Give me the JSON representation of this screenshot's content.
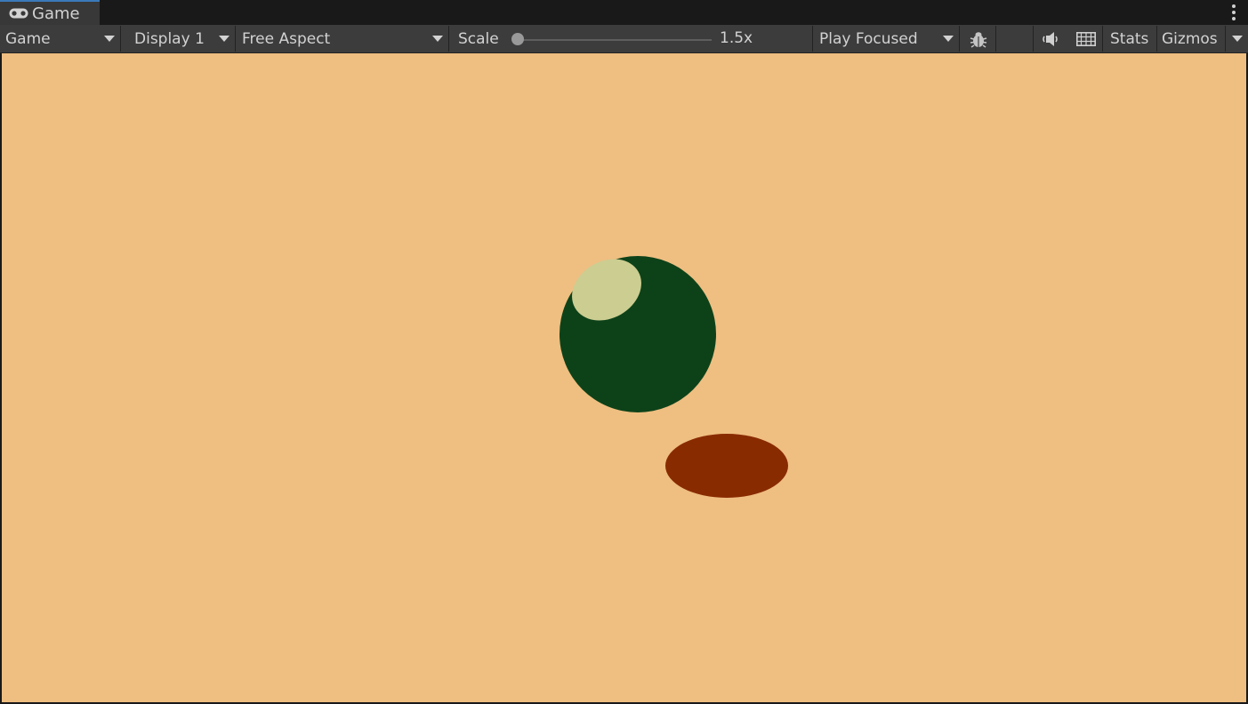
{
  "tab": {
    "title": "Game",
    "icon": "gamepad-icon"
  },
  "toolbar": {
    "view_mode": "Game",
    "display": "Display 1",
    "aspect": "Free Aspect",
    "scale_label": "Scale",
    "scale_value": "1.5x",
    "play_mode": "Play Focused",
    "stats_label": "Stats",
    "gizmos_label": "Gizmos"
  },
  "scene": {
    "background_color": "#efbe81",
    "sphere_color": "#0d4219",
    "sphere_highlight_color": "#cccd91",
    "shadow_color": "#892b00"
  }
}
